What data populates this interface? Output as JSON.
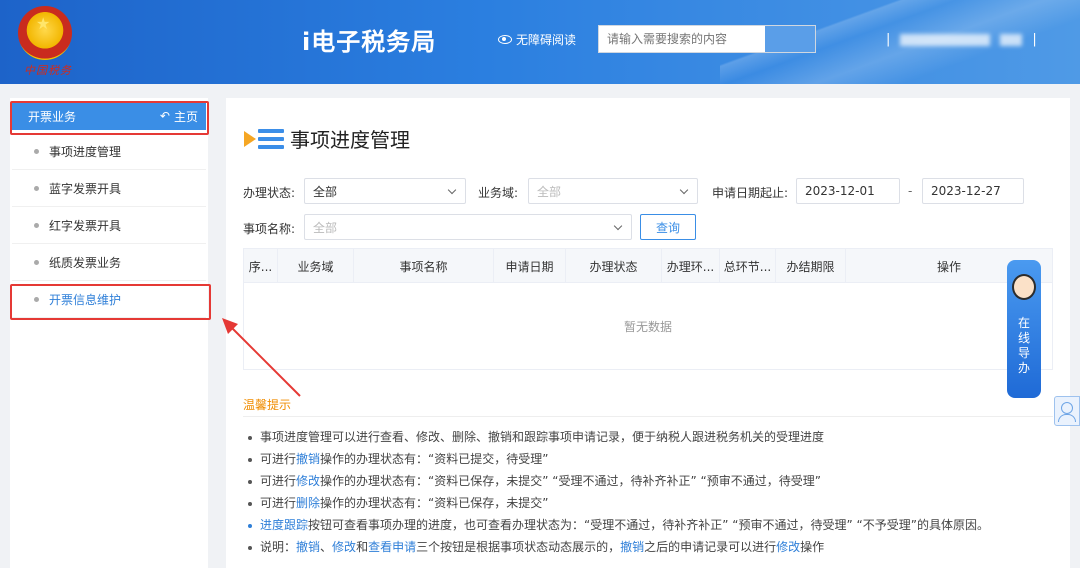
{
  "header": {
    "site_title": "i电子税务局",
    "seal_text": "中国税务",
    "accessible_label": "无障碍阅读",
    "search_placeholder": "请输入需要搜索的内容",
    "separator": "|"
  },
  "sidebar": {
    "section_title": "开票业务",
    "home_label": "主页",
    "items": [
      {
        "label": "事项进度管理"
      },
      {
        "label": "蓝字发票开具"
      },
      {
        "label": "红字发票开具"
      },
      {
        "label": "纸质发票业务"
      },
      {
        "label": "开票信息维护"
      }
    ]
  },
  "main": {
    "page_title": "事项进度管理",
    "filters": {
      "status_label": "办理状态:",
      "status_value": "全部",
      "domain_label": "业务域:",
      "domain_value": "全部",
      "date_label": "申请日期起止:",
      "date_start": "2023-12-01",
      "date_sep": "-",
      "date_end": "2023-12-27",
      "name_label": "事项名称:",
      "name_value": "全部",
      "query_button": "查询"
    },
    "table": {
      "columns": [
        "序...",
        "业务域",
        "事项名称",
        "申请日期",
        "办理状态",
        "办理环...",
        "总环节...",
        "办结期限",
        "操作"
      ],
      "empty_text": "暂无数据"
    },
    "tips": {
      "title": "温馨提示",
      "line1": "事项进度管理可以进行查看、修改、删除、撤销和跟踪事项申请记录，便于纳税人跟进税务机关的受理进度",
      "line2_a": "可进行",
      "line2_link": "撤销",
      "line2_b": "操作的办理状态有：“资料已提交，待受理”",
      "line3_a": "可进行",
      "line3_link": "修改",
      "line3_b": "操作的办理状态有：“资料已保存，未提交” “受理不通过，待补齐补正” “预审不通过，待受理”",
      "line4_a": "可进行",
      "line4_link": "删除",
      "line4_b": "操作的办理状态有：“资料已保存，未提交”",
      "line5_link": "进度跟踪",
      "line5_b": "按钮可查看事项办理的进度，也可查看办理状态为：“受理不通过，待补齐补正” “预审不通过，待受理” “不予受理”的具体原因。",
      "line6_a": "说明：",
      "line6_link1": "撤销",
      "line6_sep1": "、",
      "line6_link2": "修改",
      "line6_sep2": "和",
      "line6_link3": "查看申请",
      "line6_b": "三个按钮是根据事项状态动态展示的，",
      "line6_link4": "撤销",
      "line6_c": "之后的申请记录可以进行",
      "line6_link5": "修改",
      "line6_d": "操作"
    }
  },
  "guide": {
    "label": "在线导办"
  },
  "colors": {
    "header": "#2b7fe0",
    "accent": "#3a8ee6",
    "highlight": "#e53935",
    "tips": "#f08c00"
  }
}
